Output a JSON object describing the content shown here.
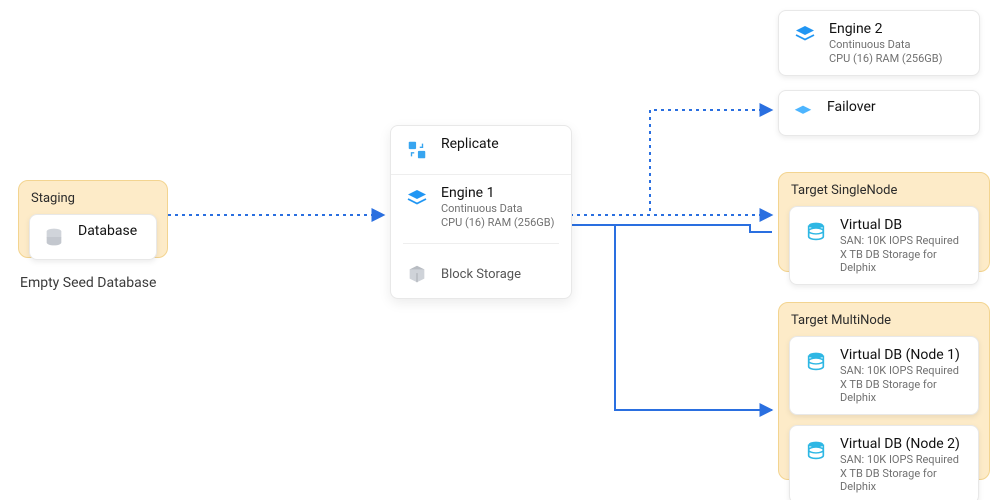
{
  "staging": {
    "group_title": "Staging",
    "caption": "Empty Seed Database",
    "card": {
      "title": "Database"
    }
  },
  "engine_panel": {
    "replicate": {
      "label": "Replicate"
    },
    "engine": {
      "title": "Engine 1",
      "subtitle_line1": "Continuous Data",
      "subtitle_line2": "CPU (16) RAM (256GB)"
    },
    "block_storage": {
      "label": "Block Storage"
    }
  },
  "engine2": {
    "title": "Engine 2",
    "subtitle_line1": "Continuous Data",
    "subtitle_line2": "CPU (16) RAM (256GB)"
  },
  "failover": {
    "title": "Failover"
  },
  "target_single": {
    "group_title": "Target SingleNode",
    "vdb": {
      "title": "Virtual DB",
      "subtitle_line1": "SAN: 10K IOPS Required",
      "subtitle_line2": "X TB DB Storage for Delphix"
    }
  },
  "target_multi": {
    "group_title": "Target MultiNode",
    "vdb1": {
      "title": "Virtual DB (Node 1)",
      "subtitle_line1": "SAN: 10K IOPS Required",
      "subtitle_line2": "X TB DB Storage for Delphix"
    },
    "vdb2": {
      "title": "Virtual DB (Node 2)",
      "subtitle_line1": "SAN: 10K IOPS Required",
      "subtitle_line2": "X TB DB Storage for Delphix"
    }
  }
}
